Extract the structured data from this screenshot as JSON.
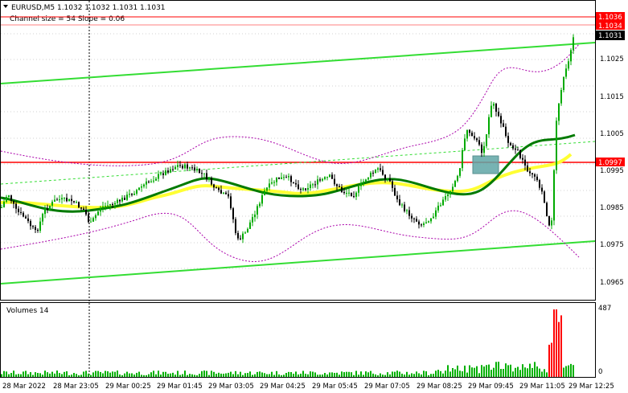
{
  "header": {
    "symbol_line": "EURUSD,M5  1.1032 1.1032 1.1031 1.1031",
    "indicator_line": "Channel size = 54 Slope = 0.06"
  },
  "volume_panel": {
    "label": "Volumes 14",
    "scale_max": "487",
    "scale_min": "0"
  },
  "price_axis": {
    "ticks": [
      "1.1025",
      "1.1015",
      "1.1005",
      "1.0995",
      "1.0985",
      "1.0975",
      "1.0965"
    ],
    "tags": [
      {
        "text": "1.1036",
        "color": "#ff0000"
      },
      {
        "text": "1.1034",
        "color": "#ff0000"
      },
      {
        "text": "1.1031",
        "color": "#000000"
      },
      {
        "text": "1.0997",
        "color": "#ff0000"
      }
    ]
  },
  "time_axis": {
    "labels": [
      "28 Mar 2022",
      "28 Mar 23:05",
      "29 Mar 00:25",
      "29 Mar 01:45",
      "29 Mar 03:05",
      "29 Mar 04:25",
      "29 Mar 05:45",
      "29 Mar 07:05",
      "29 Mar 08:25",
      "29 Mar 09:45",
      "29 Mar 11:05",
      "29 Mar 12:25"
    ]
  },
  "colors": {
    "bull": "#00aa00",
    "bear": "#000000",
    "ma_fast": "#007a00",
    "ma_slow": "#ffff33",
    "channel": "#33dd33",
    "level": "#ff0000",
    "band": "#aa00aa",
    "volume": "#00b000",
    "volume_peak": "#ff0000"
  }
}
